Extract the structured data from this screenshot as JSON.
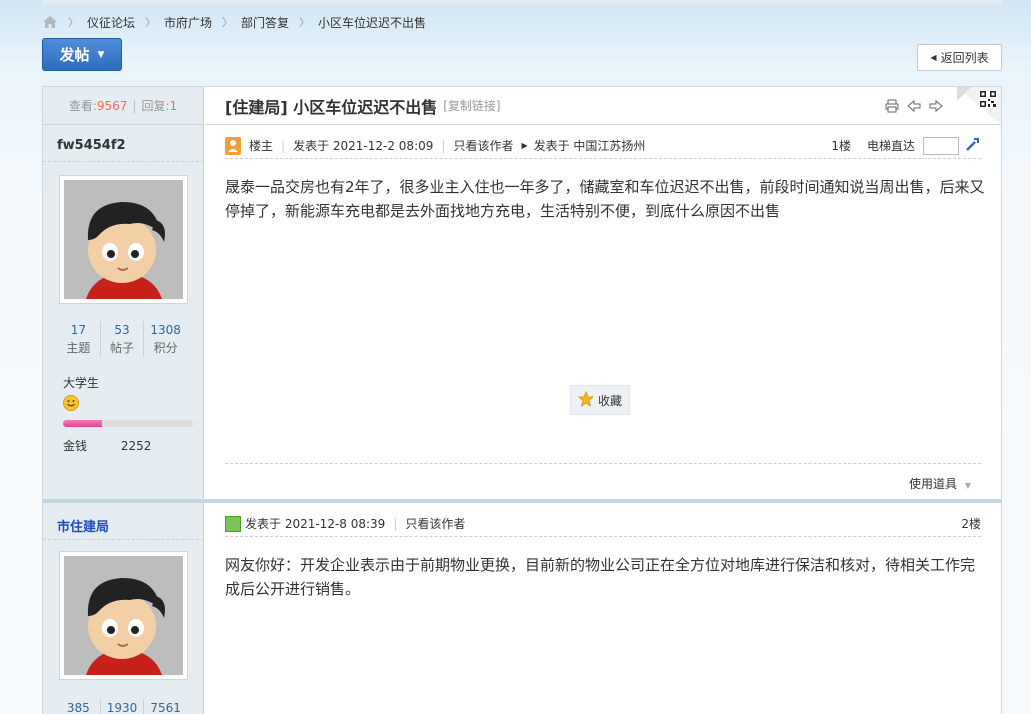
{
  "breadcrumb": {
    "items": [
      "仪征论坛",
      "市府广场",
      "部门答复",
      "小区车位迟迟不出售"
    ]
  },
  "actions": {
    "post_label": "发帖",
    "back_label": "返回列表"
  },
  "thread": {
    "views_label": "查看:",
    "views": "9567",
    "replies_label": "回复:",
    "replies": "1",
    "title": "[住建局] 小区车位迟迟不出售",
    "copy_link": "[复制链接]"
  },
  "posts": [
    {
      "author": "fw5454f2",
      "stats": [
        {
          "value": "17",
          "label": "主题"
        },
        {
          "value": "53",
          "label": "帖子"
        },
        {
          "value": "1308",
          "label": "积分"
        }
      ],
      "rank": "大学生",
      "level_progress": 0.3,
      "money_label": "金钱",
      "money": "2252",
      "host_label": "楼主",
      "posted_at": "发表于 2021-12-2 08:09",
      "only_author": "只看该作者",
      "location": "发表于 中国江苏扬州",
      "floor": "1楼",
      "jump_label": "电梯直达",
      "content": "晟泰一品交房也有2年了，很多业主入住也一年多了，储藏室和车位迟迟不出售，前段时间通知说当周出售，后来又停掉了，新能源车充电都是去外面找地方充电，生活特别不便，到底什么原因不出售",
      "favorite_label": "收藏",
      "use_tools": "使用道具"
    },
    {
      "author": "市住建局",
      "stats": [
        {
          "value": "385"
        },
        {
          "value": "1930"
        },
        {
          "value": "7561"
        }
      ],
      "posted_at": "发表于 2021-12-8 08:39",
      "only_author": "只看该作者",
      "floor": "2楼",
      "content": "网友你好：开发企业表示由于前期物业更换，目前新的物业公司正在全方位对地库进行保洁和核对，待相关工作完成后公开进行销售。"
    }
  ],
  "colors": {
    "accent_blue": "#2c6cbd",
    "count_orange": "#f26c4f",
    "side_bg": "#e5edf2",
    "progress_pink": "#e04590"
  }
}
